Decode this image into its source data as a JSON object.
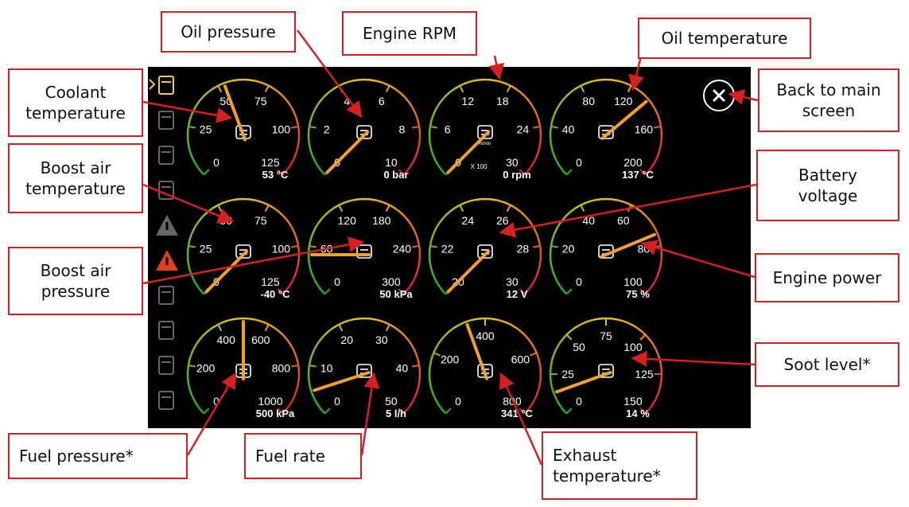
{
  "colors": {
    "background": "#000000",
    "tick_label": "#ffffff",
    "needle": "#f0a030",
    "arc_green": "#22b022",
    "arc_yellow": "#e8c020",
    "arc_red": "#d82020",
    "callout_border": "#d42020",
    "sidebar_active": "#f0d020",
    "sidebar_warning": "#e04020",
    "sidebar_inactive": "#666666"
  },
  "sidebar": {
    "items": [
      {
        "icon": "fuel-pump-icon",
        "state": "active"
      },
      {
        "icon": "glow-plug-icon",
        "state": "inactive"
      },
      {
        "icon": "coolant-level-icon",
        "state": "inactive"
      },
      {
        "icon": "temperature-icon",
        "state": "inactive"
      },
      {
        "icon": "warning-triangle-icon",
        "state": "inactive"
      },
      {
        "icon": "warning-triangle-icon",
        "state": "warning"
      },
      {
        "icon": "exhaust-filter-icon",
        "state": "inactive"
      },
      {
        "icon": "exhaust-filter-icon",
        "state": "inactive"
      },
      {
        "icon": "coolant-temp-icon",
        "state": "inactive"
      },
      {
        "icon": "soot-filter-icon",
        "state": "inactive"
      }
    ]
  },
  "close_button": {
    "icon": "close-icon"
  },
  "gauges": [
    {
      "id": "coolant-temperature",
      "icon": "thermometer-icon",
      "ticks": [
        "0",
        "25",
        "50",
        "75",
        "100",
        "125"
      ],
      "min": 0,
      "max": 125,
      "value": 53,
      "reading": "53 °C"
    },
    {
      "id": "oil-pressure",
      "icon": "oil-can-icon",
      "ticks": [
        "0",
        "2",
        "4",
        "6",
        "8",
        "10"
      ],
      "min": 0,
      "max": 10,
      "value": 0,
      "reading": "0 bar"
    },
    {
      "id": "engine-rpm",
      "icon": "engine-speed-icon",
      "ticks": [
        "0",
        "6",
        "12",
        "18",
        "24",
        "30"
      ],
      "min": 0,
      "max": 30,
      "value": 0,
      "reading": "0 rpm",
      "multiplier": "X 100",
      "sublabel": "n/min"
    },
    {
      "id": "oil-temperature",
      "icon": "oil-temp-icon",
      "ticks": [
        "0",
        "40",
        "80",
        "120",
        "160",
        "200"
      ],
      "min": 0,
      "max": 200,
      "value": 137,
      "reading": "137 °C"
    },
    {
      "id": "boost-air-temperature",
      "icon": "turbo-temp-icon",
      "ticks": [
        "0",
        "25",
        "50",
        "75",
        "100",
        "125"
      ],
      "min": -40,
      "max": 125,
      "value": -40,
      "reading": "-40 °C"
    },
    {
      "id": "boost-air-pressure",
      "icon": "turbo-icon",
      "ticks": [
        "0",
        "60",
        "120",
        "180",
        "240",
        "300"
      ],
      "min": 0,
      "max": 300,
      "value": 50,
      "reading": "50 kPa"
    },
    {
      "id": "battery-voltage",
      "icon": "battery-icon",
      "ticks": [
        "20",
        "22",
        "24",
        "26",
        "28",
        "30"
      ],
      "min": 20,
      "max": 30,
      "value": 12,
      "reading": "12 V"
    },
    {
      "id": "engine-power",
      "icon": "engine-power-icon",
      "ticks": [
        "0",
        "20",
        "40",
        "60",
        "80",
        "100"
      ],
      "min": 0,
      "max": 100,
      "value": 75,
      "reading": "75 %"
    },
    {
      "id": "fuel-pressure",
      "icon": "fuel-pressure-icon",
      "ticks": [
        "0",
        "200",
        "400",
        "600",
        "800",
        "1000"
      ],
      "min": 0,
      "max": 1000,
      "value": 500,
      "reading": "500 kPa"
    },
    {
      "id": "fuel-rate",
      "icon": "fuel-rate-icon",
      "ticks": [
        "0",
        "10",
        "20",
        "30",
        "40",
        "50"
      ],
      "min": 0,
      "max": 50,
      "value": 5,
      "reading": "5 l/h"
    },
    {
      "id": "exhaust-temperature",
      "icon": "exhaust-temp-icon",
      "ticks": [
        "0",
        "200",
        "400",
        "600",
        "800"
      ],
      "min": 0,
      "max": 800,
      "value": 341,
      "reading": "341 °C"
    },
    {
      "id": "soot-level",
      "icon": "soot-filter-icon",
      "ticks": [
        "0",
        "25",
        "50",
        "75",
        "100",
        "125",
        "150"
      ],
      "min": 0,
      "max": 150,
      "value": 14,
      "reading": "14 %"
    }
  ],
  "callouts": [
    {
      "id": "oil-pressure",
      "text": "Oil pressure"
    },
    {
      "id": "engine-rpm",
      "text": "Engine RPM"
    },
    {
      "id": "oil-temperature",
      "text": "Oil temperature"
    },
    {
      "id": "coolant-temperature",
      "text": "Coolant\ntemperature"
    },
    {
      "id": "back-to-main",
      "text": "Back to main\nscreen"
    },
    {
      "id": "boost-air-temperature",
      "text": "Boost air\ntemperature"
    },
    {
      "id": "battery-voltage",
      "text": "Battery\nvoltage"
    },
    {
      "id": "boost-air-pressure",
      "text": "Boost air\npressure"
    },
    {
      "id": "engine-power",
      "text": "Engine power"
    },
    {
      "id": "soot-level",
      "text": "Soot level*"
    },
    {
      "id": "fuel-pressure",
      "text": "Fuel pressure*"
    },
    {
      "id": "fuel-rate",
      "text": "Fuel rate"
    },
    {
      "id": "exhaust-temperature",
      "text": "Exhaust\ntemperature*"
    }
  ]
}
